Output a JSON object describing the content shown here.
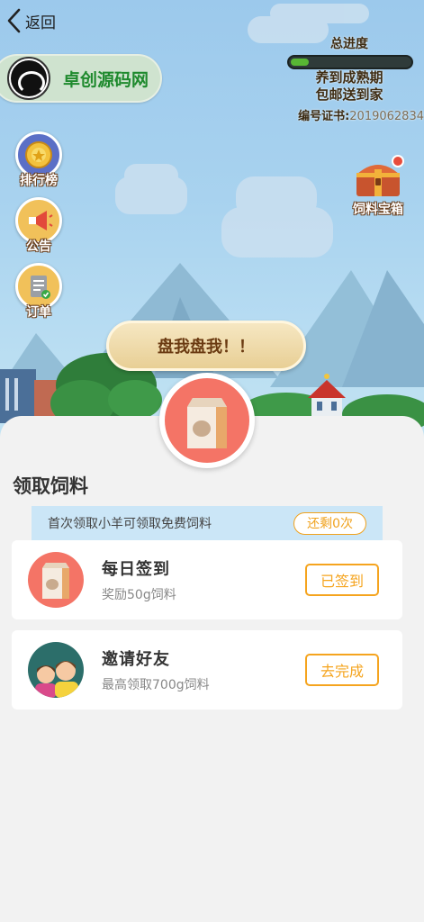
{
  "header": {
    "back_label": "返回",
    "back_icon": "chevron-left-icon"
  },
  "profile": {
    "name": "卓创源码网"
  },
  "progress": {
    "title": "总进度",
    "fraction": 0.15,
    "line1": "养到成熟期",
    "line2": "包邮送到家",
    "cert_label": "编号证书:",
    "cert_number": "2019062834"
  },
  "sidebar": {
    "items": [
      {
        "label": "排行榜",
        "icon": "medal-icon"
      },
      {
        "label": "公告",
        "icon": "megaphone-icon"
      },
      {
        "label": "订单",
        "icon": "clipboard-icon"
      }
    ]
  },
  "chest": {
    "label": "饲料宝箱",
    "icon": "treasure-chest-icon"
  },
  "pan_button": {
    "label": "盘我盘我！！"
  },
  "sheet": {
    "title": "领取饲料",
    "info_text": "首次领取小羊可领取免费饲料",
    "remaining": "还剩0次",
    "tasks": [
      {
        "title": "每日签到",
        "desc": "奖励50g饲料",
        "button": "已签到",
        "icon": "feed-bag-icon"
      },
      {
        "title": "邀请好友",
        "desc": "最高领取700g饲料",
        "button": "去完成",
        "icon": "friends-icon"
      }
    ]
  },
  "colors": {
    "accent_orange": "#f5a41e",
    "brand_green": "#1f8a2e",
    "info_bar_blue": "#cbe6f7",
    "icon_red": "#f47466"
  }
}
